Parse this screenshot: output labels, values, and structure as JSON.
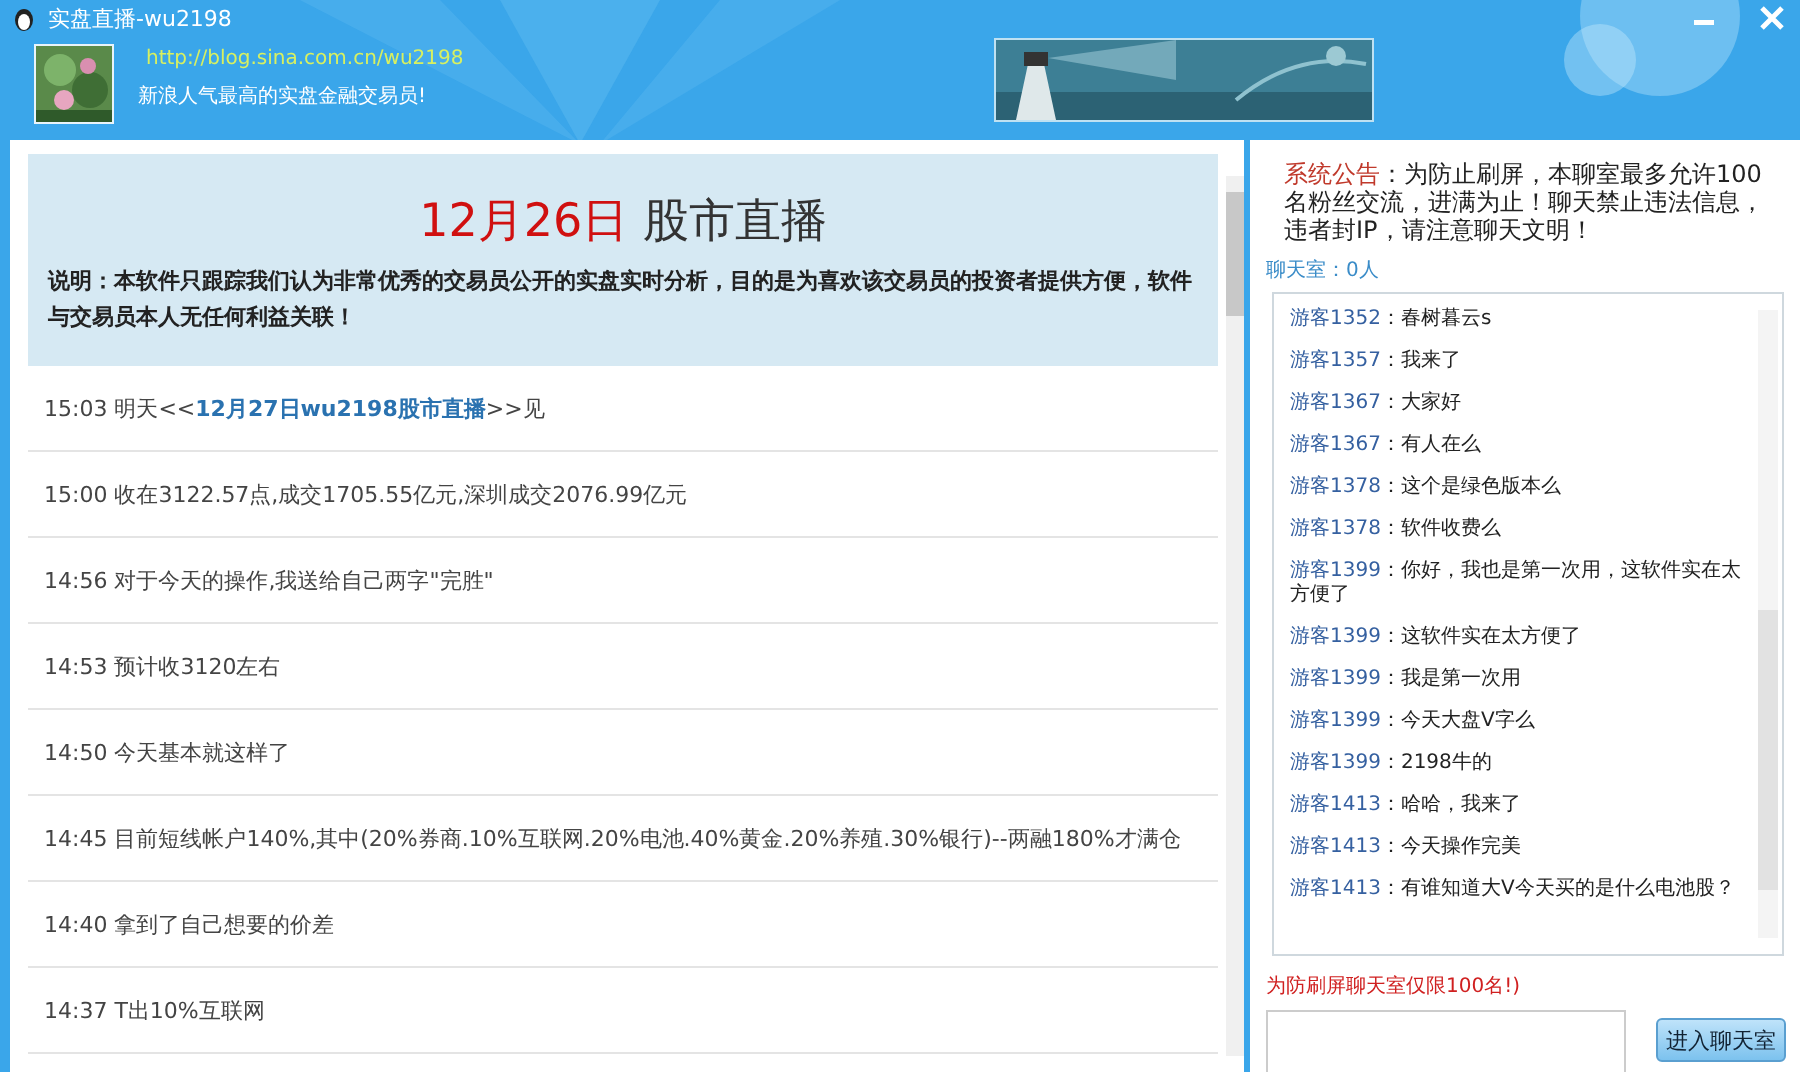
{
  "window": {
    "title": "实盘直播-wu2198"
  },
  "header": {
    "link": "http://blog.sina.com.cn/wu2198",
    "slogan": "新浪人气最高的实盘金融交易员!"
  },
  "broadcast": {
    "date": "12月26日",
    "title": "股市直播",
    "notice": "说明：本软件只跟踪我们认为非常优秀的交易员公开的实盘实时分析，目的是为喜欢该交易员的投资者提供方便，软件与交易员本人无任何利益关联！"
  },
  "posts": [
    {
      "time": "15:03",
      "text": "明天<<",
      "link": "12月27日wu2198股市直播",
      "after": ">>见"
    },
    {
      "time": "15:00",
      "text": "收在3122.57点,成交1705.55亿元,深圳成交2076.99亿元"
    },
    {
      "time": "14:56",
      "text": "对于今天的操作,我送给自己两字\"完胜\""
    },
    {
      "time": "14:53",
      "text": "预计收3120左右"
    },
    {
      "time": "14:50",
      "text": "今天基本就这样了"
    },
    {
      "time": "14:45",
      "text": "目前短线帐户140%,其中(20%券商.10%互联网.20%电池.40%黄金.20%养殖.30%银行)--两融180%才满仓"
    },
    {
      "time": "14:40",
      "text": "拿到了自己想要的价差"
    },
    {
      "time": "14:37",
      "text": "T出10%互联网"
    }
  ],
  "chat": {
    "announcement_label": "系统公告",
    "announcement": "：为防止刷屏，本聊室最多允许100名粉丝交流，进满为止！聊天禁止违法信息，违者封IP，请注意聊天文明！",
    "room_label": "聊天室",
    "room_count": "：0人",
    "messages": [
      {
        "user": "游客1352",
        "text": "：春树暮云s"
      },
      {
        "user": "游客1357",
        "text": "：我来了"
      },
      {
        "user": "游客1367",
        "text": "：大家好"
      },
      {
        "user": "游客1367",
        "text": "：有人在么"
      },
      {
        "user": "游客1378",
        "text": "：这个是绿色版本么"
      },
      {
        "user": "游客1378",
        "text": "：软件收费么"
      },
      {
        "user": "游客1399",
        "text": "：你好，我也是第一次用，这软件实在太方便了"
      },
      {
        "user": "游客1399",
        "text": "：这软件实在太方便了"
      },
      {
        "user": "游客1399",
        "text": "：我是第一次用"
      },
      {
        "user": "游客1399",
        "text": "：今天大盘V字么"
      },
      {
        "user": "游客1399",
        "text": "：2198牛的"
      },
      {
        "user": "游客1413",
        "text": "：哈哈，我来了"
      },
      {
        "user": "游客1413",
        "text": "：今天操作完美"
      },
      {
        "user": "游客1413",
        "text": "：有谁知道大V今天买的是什么电池股？"
      }
    ],
    "limit_note": "为防刷屏聊天室仅限100名!)",
    "enter_button": "进入聊天室"
  }
}
